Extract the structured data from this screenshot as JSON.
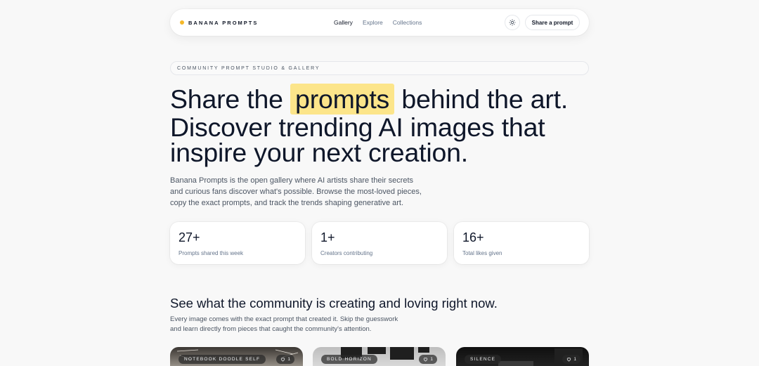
{
  "nav": {
    "brand": "BANANA PROMPTS",
    "links": [
      {
        "label": "Gallery",
        "active": true
      },
      {
        "label": "Explore",
        "active": false
      },
      {
        "label": "Collections",
        "active": false
      }
    ],
    "theme_icon": "sun-icon",
    "share_label": "Share a prompt"
  },
  "hero": {
    "kicker": "COMMUNITY PROMPT STUDIO & GALLERY",
    "title_before": "Share the ",
    "title_highlight": "prompts",
    "title_after": " behind the art. Discover trending AI images that inspire your next creation.",
    "lede": "Banana Prompts is the open gallery where AI artists share their secrets and curious fans discover what's possible. Browse the most-loved pieces, copy the exact prompts, and track the trends shaping generative art."
  },
  "stats": [
    {
      "value": "27+",
      "label": "Prompts shared this week"
    },
    {
      "value": "1+",
      "label": "Creators contributing"
    },
    {
      "value": "16+",
      "label": "Total likes given"
    }
  ],
  "community": {
    "title": "See what the community is creating and loving right now.",
    "description": "Every image comes with the exact prompt that created it. Skip the guesswork and learn directly from pieces that caught the community's attention."
  },
  "cards": [
    {
      "tag": "NOTEBOOK DOODLE SELF",
      "likes": "1"
    },
    {
      "tag": "BOLD HORIZON",
      "likes": "1"
    },
    {
      "tag": "SILENCE",
      "likes": "1"
    }
  ],
  "colors": {
    "accent": "#f5b829",
    "highlight": "#fce58a",
    "background": "#f8f8f8"
  }
}
